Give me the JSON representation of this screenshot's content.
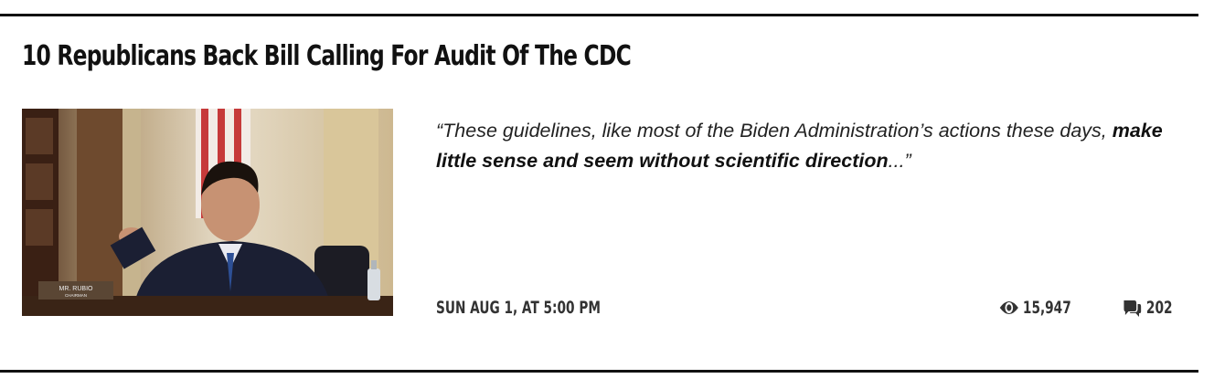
{
  "article": {
    "title": "10 Republicans Back Bill Calling For Audit Of The CDC",
    "image_alt": "Senator at a hearing",
    "image_nameplate": [
      "MR. RUBIO",
      "CHAIRMAN"
    ],
    "quote": {
      "open": "“These guidelines, like most of the Biden Administration’s actions these days, ",
      "bold": "make little sense and seem without scientific direction",
      "close": "...”"
    },
    "date": "SUN AUG 1, AT 5:00 PM",
    "views": "15,947",
    "comments": "202",
    "icons": {
      "views": "eye-icon",
      "comments": "comments-icon"
    }
  }
}
